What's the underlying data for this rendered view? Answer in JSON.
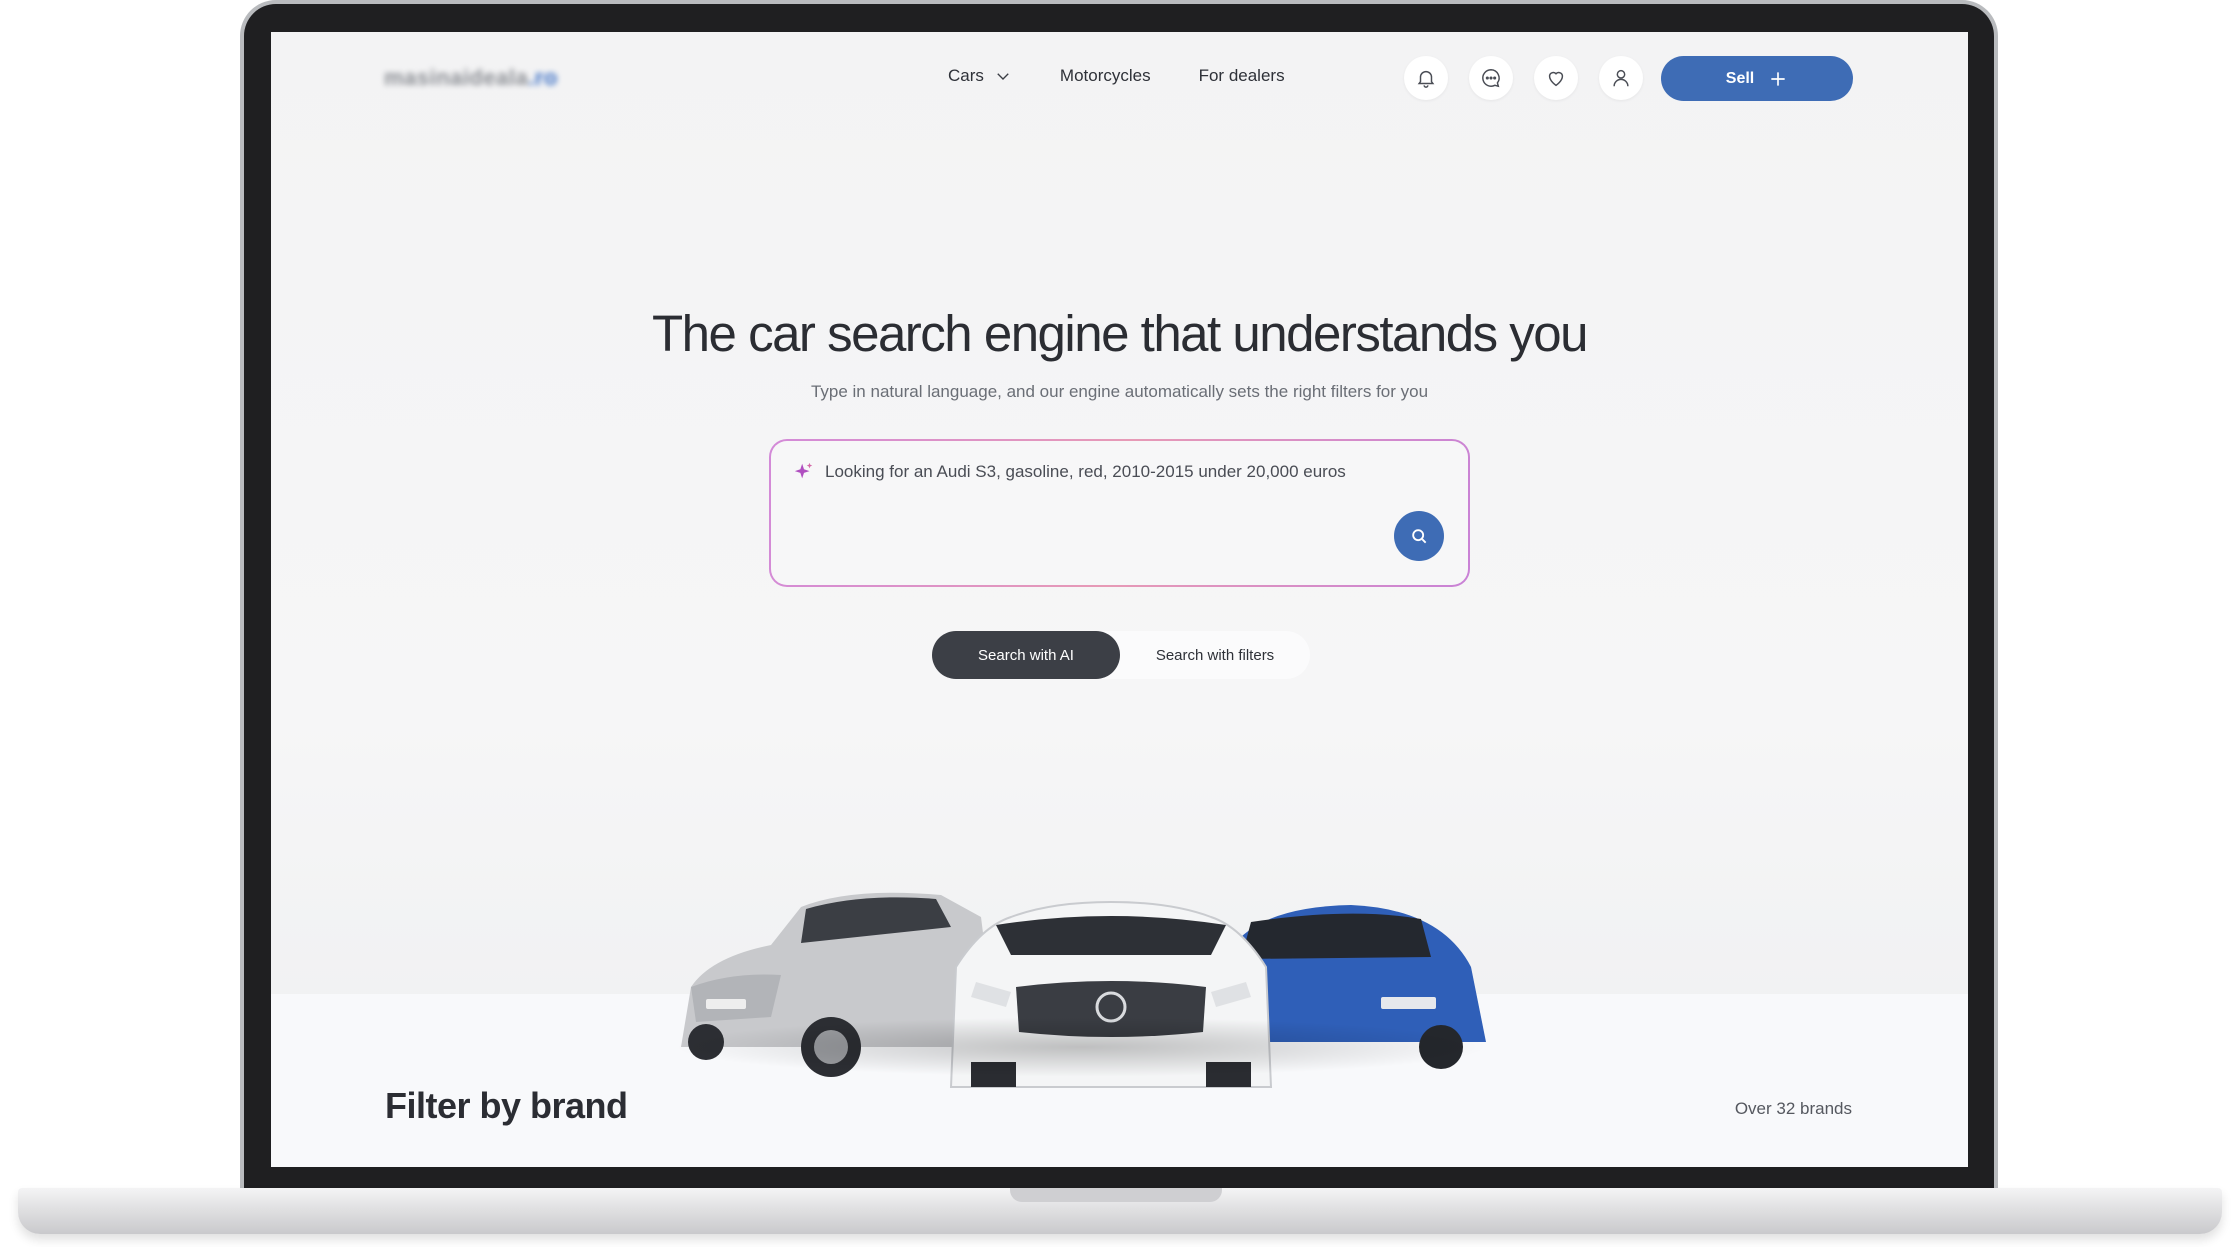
{
  "header": {
    "logo_text_main": "masinaideala",
    "logo_text_accent": ".ro",
    "nav": [
      {
        "label": "Cars",
        "has_dropdown": true
      },
      {
        "label": "Motorcycles"
      },
      {
        "label": "For dealers"
      }
    ],
    "icons": [
      "bell-icon",
      "chat-icon",
      "heart-icon",
      "user-icon"
    ],
    "sell_label": "Sell"
  },
  "hero": {
    "title": "The car search engine that understands you",
    "subtitle": "Type in natural language, and our engine automatically sets the right filters for you",
    "search_value": "Looking for an Audi S3, gasoline, red, 2010-2015 under 20,000 euros"
  },
  "mode_toggle": {
    "active": "Search with AI",
    "inactive": "Search with filters"
  },
  "cars": [
    "silver-hatchback",
    "white-mercedes-sedan",
    "blue-volkswagen-hatchback"
  ],
  "brands": {
    "title": "Filter by brand",
    "count_text": "Over 32 brands"
  },
  "colors": {
    "primary": "#3e6cb5",
    "dark_button": "#3c3f46",
    "search_border_start": "#d38ad8",
    "search_border_end": "#c982d6"
  }
}
